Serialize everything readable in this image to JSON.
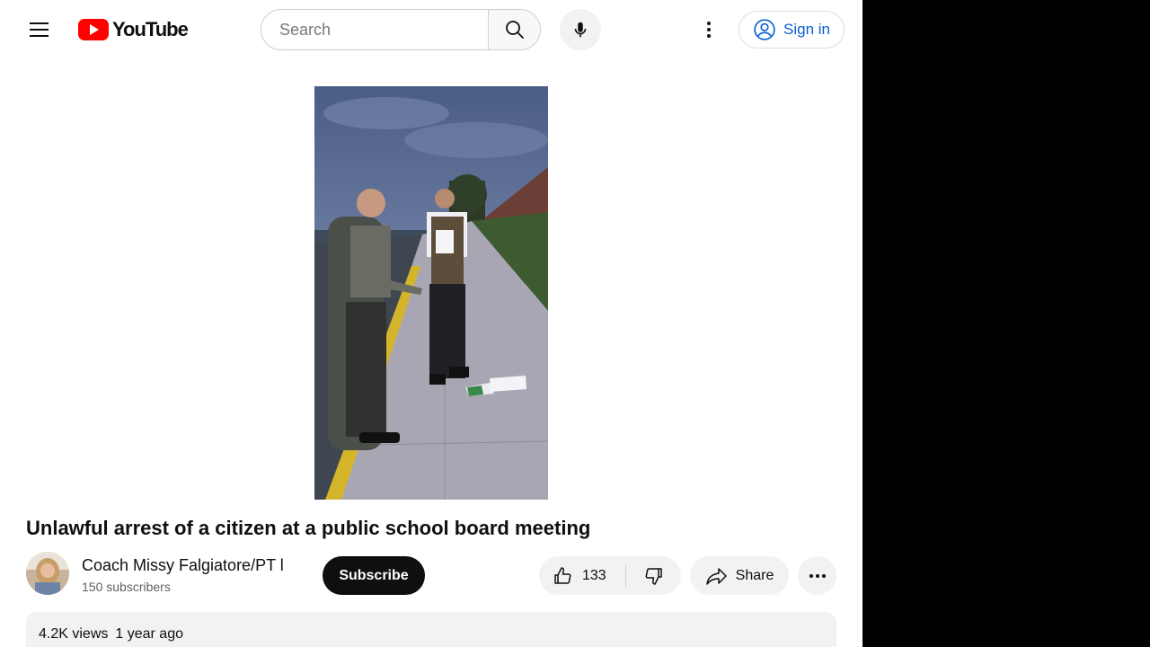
{
  "header": {
    "logo_text": "YouTube",
    "search_placeholder": "Search",
    "signin_label": "Sign in"
  },
  "video": {
    "title": "Unlawful arrest of a citizen at a public school board meeting"
  },
  "channel": {
    "name": "Coach Missy Falgiatore/PT l",
    "subscribers": "150 subscribers",
    "subscribe_label": "Subscribe"
  },
  "actions": {
    "like_count": "133",
    "share_label": "Share"
  },
  "description": {
    "views": "4.2K views",
    "age": "1 year ago"
  },
  "colors": {
    "brand_red": "#ff0000",
    "link_blue": "#065fd4",
    "button_bg": "#f2f2f2"
  }
}
